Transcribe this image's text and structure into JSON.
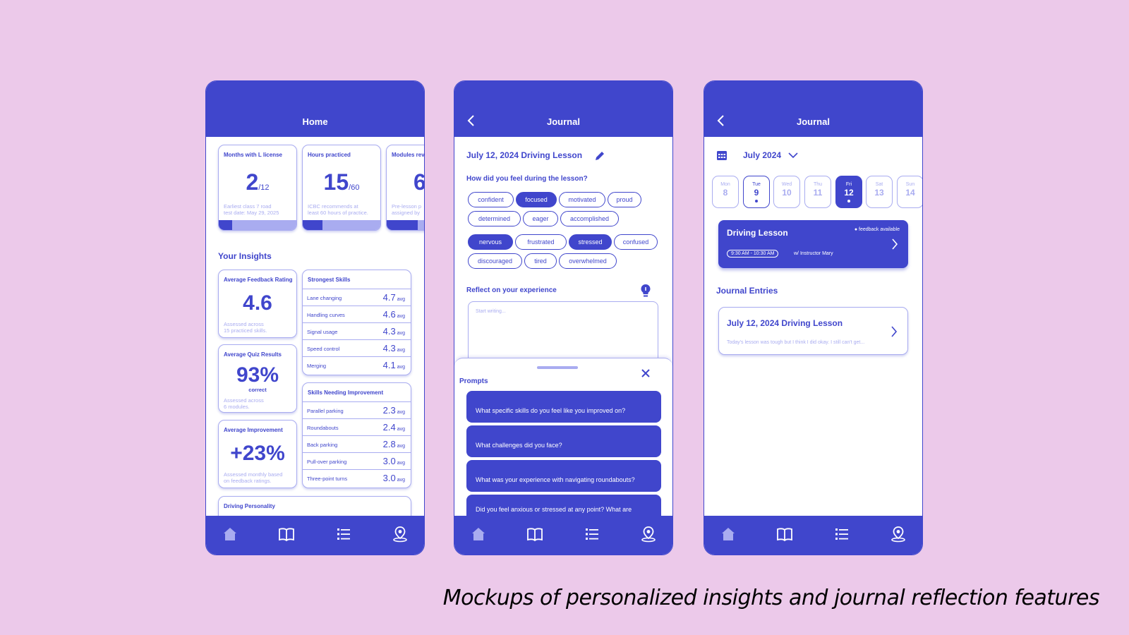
{
  "colors": {
    "accent": "#4046cc",
    "light_accent": "#a9acf0",
    "background": "#ecc9ea"
  },
  "caption": "Mockups of personalized insights and journal reflection features",
  "home": {
    "title": "Home",
    "stats": [
      {
        "label": "Months with L license",
        "value": "2",
        "total": "/12",
        "note1": "Earliest class 7 road",
        "note2": "test date: May 29, 2025",
        "progress": 0.17
      },
      {
        "label": "Hours practiced",
        "value": "15",
        "total": "/60",
        "note1": "ICBC recommends at",
        "note2": "least 60 hours of practice.",
        "progress": 0.25
      },
      {
        "label": "Modules rev",
        "value": "6",
        "total": "",
        "note1": "Pre-lesson p",
        "note2": "assigned by",
        "progress": 0.4
      }
    ],
    "insights_heading": "Your Insights",
    "feedback": {
      "label": "Average Feedback Rating",
      "value": "4.6",
      "note1": "Assessed across",
      "note2": "15 practiced skills."
    },
    "quiz": {
      "label": "Average Quiz Results",
      "value": "93%",
      "sub": "correct",
      "note1": "Assessed across",
      "note2": "6 modules."
    },
    "improvement": {
      "label": "Average Improvement",
      "value": "+23%",
      "note1": "Assessed monthly based",
      "note2": "on feedback ratings."
    },
    "strongest": {
      "label": "Strongest Skills",
      "avg_unit": "avg",
      "rows": [
        {
          "name": "Lane changing",
          "value": "4.7"
        },
        {
          "name": "Handling curves",
          "value": "4.6"
        },
        {
          "name": "Signal usage",
          "value": "4.3"
        },
        {
          "name": "Speed control",
          "value": "4.3"
        },
        {
          "name": "Merging",
          "value": "4.1"
        }
      ]
    },
    "needing": {
      "label": "Skills Needing Improvement",
      "rows": [
        {
          "name": "Parallel parking",
          "value": "2.3"
        },
        {
          "name": "Roundabouts",
          "value": "2.4"
        },
        {
          "name": "Back parking",
          "value": "2.8"
        },
        {
          "name": "Pull-over parking",
          "value": "3.0"
        },
        {
          "name": "Three-point turns",
          "value": "3.0"
        }
      ]
    },
    "personality_label": "Driving Personality"
  },
  "journal_entry": {
    "title": "Journal",
    "entry_title": "July 12, 2024 Driving Lesson",
    "feel_question": "How did you feel during the lesson?",
    "chips_row1": [
      {
        "label": "confident",
        "selected": false
      },
      {
        "label": "focused",
        "selected": true
      },
      {
        "label": "motivated",
        "selected": false
      },
      {
        "label": "proud",
        "selected": false
      }
    ],
    "chips_row2": [
      {
        "label": "determined",
        "selected": false
      },
      {
        "label": "eager",
        "selected": false
      },
      {
        "label": "accomplished",
        "selected": false
      }
    ],
    "chips_row3": [
      {
        "label": "nervous",
        "selected": true
      },
      {
        "label": "frustrated",
        "selected": false
      },
      {
        "label": "stressed",
        "selected": true
      },
      {
        "label": "confused",
        "selected": false
      }
    ],
    "chips_row4": [
      {
        "label": "discouraged",
        "selected": false
      },
      {
        "label": "tired",
        "selected": false
      },
      {
        "label": "overwhelmed",
        "selected": false
      }
    ],
    "reflect_heading": "Reflect on your experience",
    "placeholder": "Start writing...",
    "prompts_heading": "Prompts",
    "prompts": [
      "What specific skills do you feel like you improved on?",
      "What challenges did you face?",
      "What was your experience with navigating roundabouts?",
      "Did you feel anxious or stressed at any point? What are"
    ]
  },
  "journal_calendar": {
    "title": "Journal",
    "month": "July 2024",
    "days": [
      {
        "name": "Mon",
        "num": "8",
        "style": "plain",
        "dot": false
      },
      {
        "name": "Tue",
        "num": "9",
        "style": "strong",
        "dot": true
      },
      {
        "name": "Wed",
        "num": "10",
        "style": "plain",
        "dot": false
      },
      {
        "name": "Thu",
        "num": "11",
        "style": "plain",
        "dot": false
      },
      {
        "name": "Fri",
        "num": "12",
        "style": "sel",
        "dot": true
      },
      {
        "name": "Sat",
        "num": "13",
        "style": "plain",
        "dot": false
      },
      {
        "name": "Sun",
        "num": "14",
        "style": "plain",
        "dot": false
      }
    ],
    "lesson": {
      "title": "Driving Lesson",
      "badge": "● feedback available",
      "time": "9:30 AM - 10:30 AM",
      "instructor": "w/ Instructor Mary"
    },
    "entries_heading": "Journal Entries",
    "entry": {
      "title": "July 12, 2024 Driving Lesson",
      "preview": "Today's lesson was tough but I think I did okay. I still can't get..."
    }
  }
}
